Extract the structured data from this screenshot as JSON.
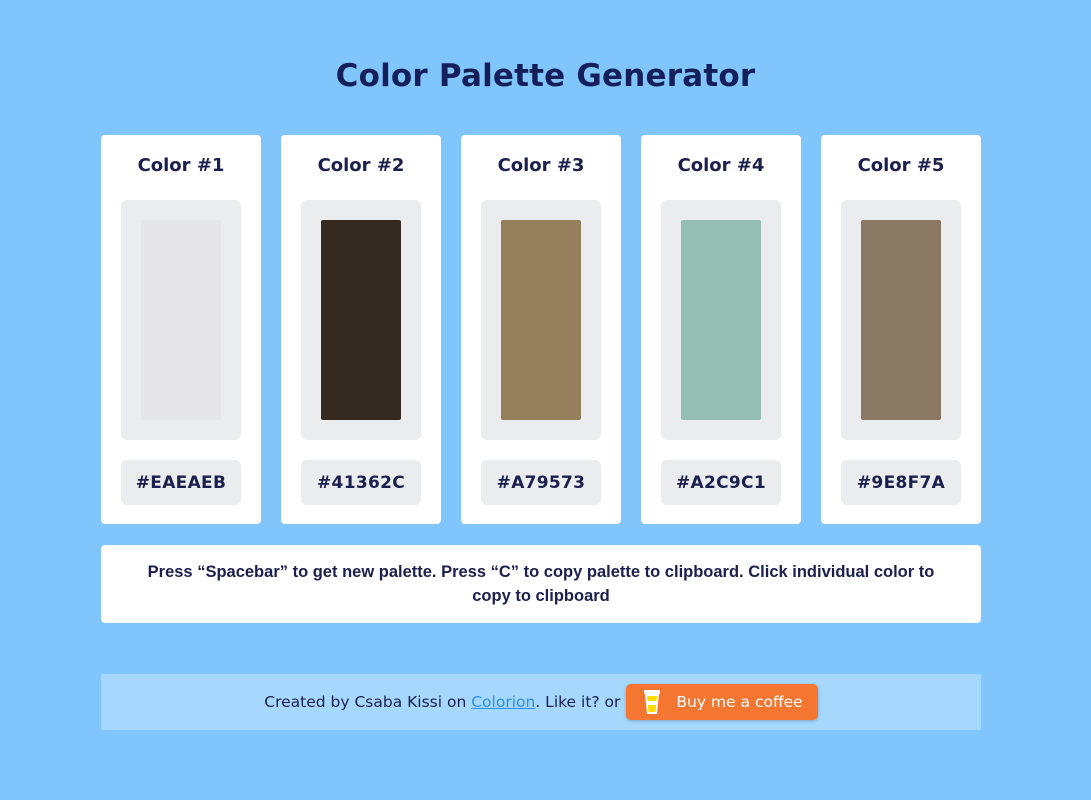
{
  "header": {
    "title": "Color Palette Generator"
  },
  "palette": [
    {
      "label": "Color #1",
      "hex": "#EAEAEB",
      "color": "#E6E6E8"
    },
    {
      "label": "Color #2",
      "hex": "#41362C",
      "color": "#342A22"
    },
    {
      "label": "Color #3",
      "hex": "#A79573",
      "color": "#95805B"
    },
    {
      "label": "Color #4",
      "hex": "#A2C9C1",
      "color": "#94BEB4"
    },
    {
      "label": "Color #5",
      "hex": "#9E8F7A",
      "color": "#8A7A63"
    }
  ],
  "instructions": "Press “Spacebar” to get new palette. Press “C” to copy palette to clipboard. Click individual color to copy to clipboard",
  "footer": {
    "prefix": "Created by Csaba Kissi on ",
    "link": "Colorion",
    "suffix": ". Like it? or",
    "button_label": "Buy me a coffee",
    "button_icon": "coffee-cup-icon"
  },
  "colors": {
    "background": "#80C5FC",
    "card": "#FFFFFF",
    "swatch_frame": "#EBECEE",
    "footer_bg": "#A6D7FD",
    "button": "#F47630",
    "link": "#2C8FE3",
    "text": "#1B1F4D"
  }
}
